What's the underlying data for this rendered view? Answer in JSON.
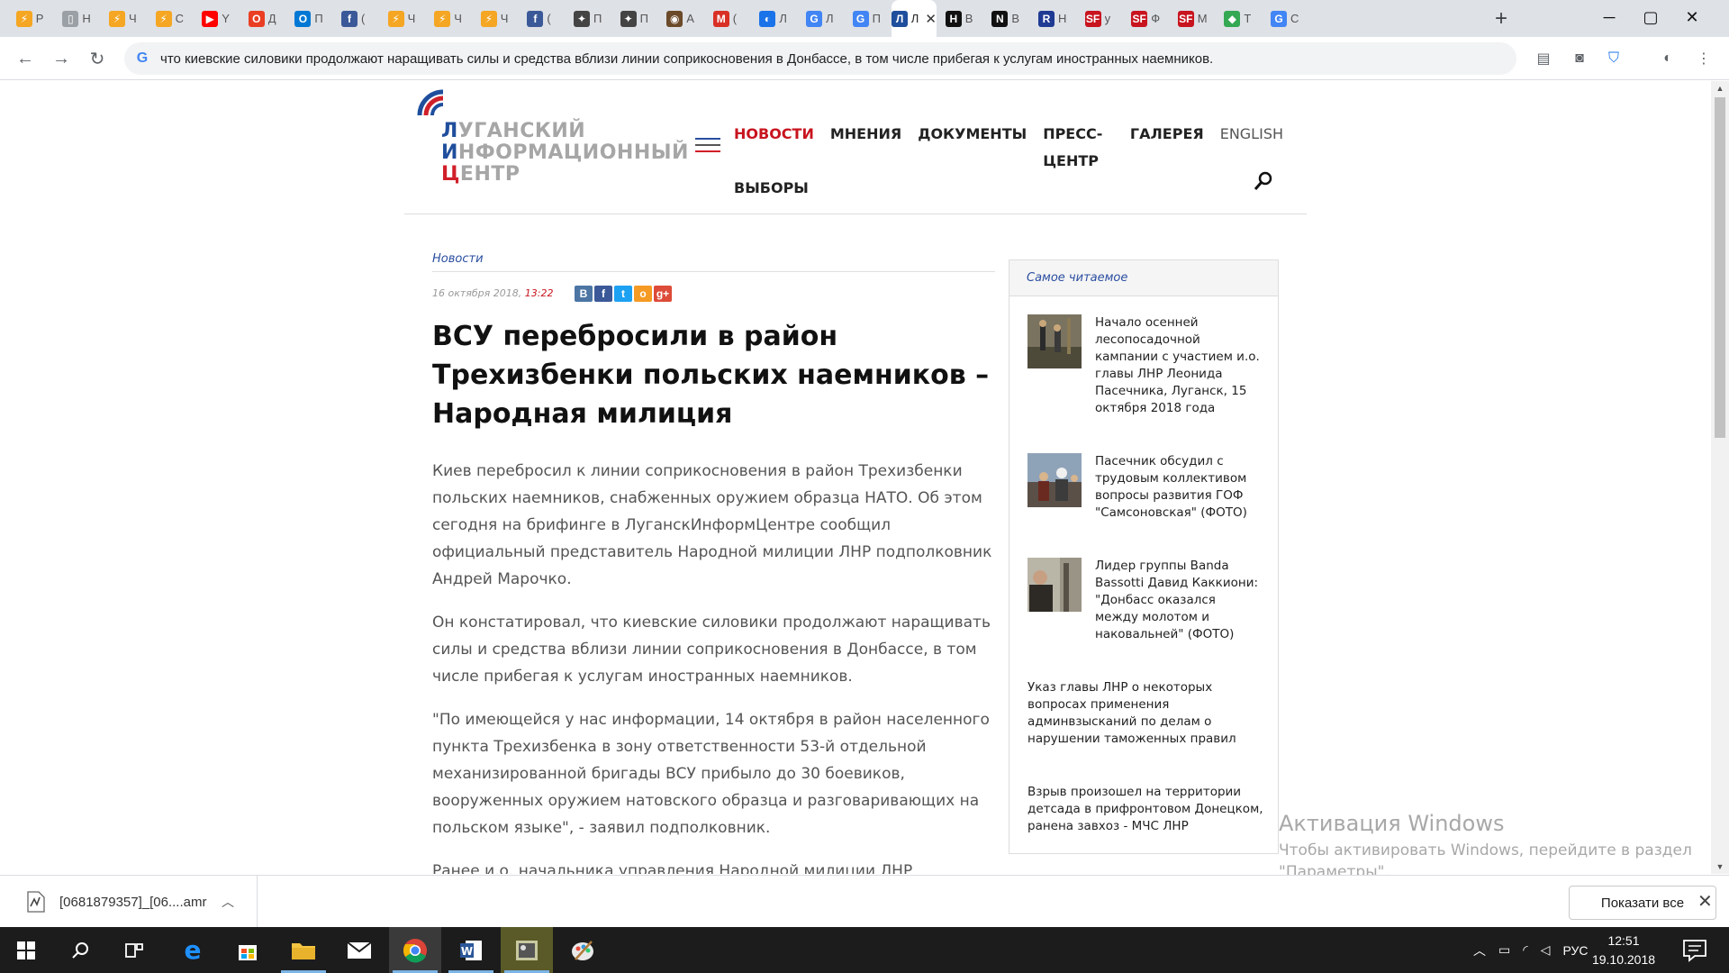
{
  "browser": {
    "tabs": [
      {
        "fav_color": "#f5a623",
        "glyph": "⚡",
        "label": "Р"
      },
      {
        "fav_color": "#9aa0a6",
        "glyph": "▯",
        "label": "Н"
      },
      {
        "fav_color": "#f5a623",
        "glyph": "⚡",
        "label": "Ч"
      },
      {
        "fav_color": "#f5a623",
        "glyph": "⚡",
        "label": "С"
      },
      {
        "fav_color": "#ff0000",
        "glyph": "▶",
        "label": "Y"
      },
      {
        "fav_color": "#ea3e23",
        "glyph": "O",
        "label": "Д"
      },
      {
        "fav_color": "#0078d4",
        "glyph": "O",
        "label": "П"
      },
      {
        "fav_color": "#3b5998",
        "glyph": "f",
        "label": "("
      },
      {
        "fav_color": "#f5a623",
        "glyph": "⚡",
        "label": "Ч"
      },
      {
        "fav_color": "#f5a623",
        "glyph": "⚡",
        "label": "Ч"
      },
      {
        "fav_color": "#f5a623",
        "glyph": "⚡",
        "label": "Ч"
      },
      {
        "fav_color": "#3b5998",
        "glyph": "f",
        "label": "("
      },
      {
        "fav_color": "#444444",
        "glyph": "✦",
        "label": "П"
      },
      {
        "fav_color": "#444444",
        "glyph": "✦",
        "label": "П"
      },
      {
        "fav_color": "#6b4a2a",
        "glyph": "◉",
        "label": "А"
      },
      {
        "fav_color": "#d93025",
        "glyph": "M",
        "label": "("
      },
      {
        "fav_color": "#1a73e8",
        "glyph": "◐",
        "label": "Л"
      },
      {
        "fav_color": "#4285f4",
        "glyph": "G",
        "label": "Л"
      },
      {
        "fav_color": "#4285f4",
        "glyph": "G",
        "label": "П"
      },
      {
        "fav_color": "#1f4e9c",
        "glyph": "Л",
        "label": "Л",
        "active": true
      },
      {
        "fav_color": "#111111",
        "glyph": "H",
        "label": "В"
      },
      {
        "fav_color": "#111111",
        "glyph": "N",
        "label": "В"
      },
      {
        "fav_color": "#1f3a93",
        "glyph": "R",
        "label": "Н"
      },
      {
        "fav_color": "#c8141e",
        "glyph": "SF",
        "label": "у"
      },
      {
        "fav_color": "#c8141e",
        "glyph": "SF",
        "label": "Ф"
      },
      {
        "fav_color": "#c8141e",
        "glyph": "SF",
        "label": "М"
      },
      {
        "fav_color": "#34a853",
        "glyph": "◆",
        "label": "Т"
      },
      {
        "fav_color": "#4285f4",
        "glyph": "G",
        "label": "С"
      }
    ],
    "new_tab_icon": "plus-icon",
    "window_controls": [
      "minimize",
      "maximize",
      "close"
    ],
    "omnibox_text": "что киевские силовики продолжают наращивать силы и средства вблизи линии соприкосновения в Донбассе, в том числе прибегая к услугам иностранных наемников."
  },
  "site": {
    "logo_lines": [
      "УГАНСКИЙ",
      "НФОРМАЦИОННЫЙ",
      "ЕНТР"
    ],
    "logo_caps": [
      "Л",
      "И",
      "Ц"
    ],
    "nav_row1": [
      "НОВОСТИ",
      "МНЕНИЯ",
      "ДОКУМЕНТЫ",
      "ПРЕСС-ЦЕНТР",
      "ГАЛЕРЕЯ"
    ],
    "nav_english": "ENGLISH",
    "nav_row2": [
      "ВЫБОРЫ"
    ],
    "brand_blue": "#1f4e9c",
    "brand_red": "#c8141e"
  },
  "article": {
    "category": "Новости",
    "date": "16 октября 2018, ",
    "time": "13:22",
    "share": [
      {
        "label": "В",
        "color": "#4c75a3"
      },
      {
        "label": "f",
        "color": "#3b5998"
      },
      {
        "label": "t",
        "color": "#1da1f2"
      },
      {
        "label": "о",
        "color": "#f59a23"
      },
      {
        "label": "g+",
        "color": "#dd4b39"
      }
    ],
    "headline": "ВСУ перебросили в район Трехизбенки польских наемников – Народная милиция",
    "paragraphs": [
      "Киев перебросил к линии соприкосновения в район Трехизбенки польских наемников, снабженных оружием образца НАТО. Об этом сегодня на брифинге в ЛуганскИнформЦентре сообщил официальный представитель Народной милиции ЛНР подполковник Андрей Марочко.",
      "Он констатировал, что киевские силовики продолжают наращивать силы и средства вблизи линии соприкосновения в Донбассе, в том числе прибегая к услугам иностранных наемников.",
      "\"По имеющейся у нас информации, 14 октября в район населенного пункта Трехизбенка в зону ответственности 53-й отдельной механизированной бригады ВСУ прибыло до 30 боевиков, вооруженных оружием натовского образца и разговаривающих на польском языке\", - заявил подполковник.",
      "Ранее и.о. начальника управления Народной милиции ЛНР полковник Михаил Филипоненко сообщал, что ВСУ разместили в селе Валуйское"
    ]
  },
  "sidebar": {
    "title": "Самое читаемое",
    "items": [
      "Начало осенней лесопосадочной кампании с участием и.о. главы ЛНР Леонида Пасечника, Луганск, 15 октября 2018 года",
      "Пасечник обсудил с трудовым коллективом вопросы развития ГОФ \"Самсоновская\" (ФОТО)",
      "Лидер группы Banda Bassotti Давид Каккиони: \"Донбасс оказался между молотом и наковальней\" (ФОТО)",
      "Указ главы ЛНР о некоторых вопросах применения админвзысканий по делам о нарушении таможенных правил",
      "Взрыв произошел на территории детсада в прифронтовом Донецком, ранена завхоз - МЧС ЛНР"
    ]
  },
  "watermark": {
    "title": "Активация Windows",
    "subtitle": "Чтобы активировать Windows, перейдите в раздел \"Параметры\"."
  },
  "downloads": {
    "file_name": "[0681879357]_[06....amr",
    "show_all": "Показати все"
  },
  "taskbar": {
    "apps": [
      "windows-start",
      "search",
      "task-view",
      "edge",
      "store",
      "file-explorer",
      "mail",
      "chrome",
      "word",
      "image-viewer",
      "paint"
    ],
    "language": "РУС",
    "time": "12:51",
    "date": "19.10.2018"
  }
}
